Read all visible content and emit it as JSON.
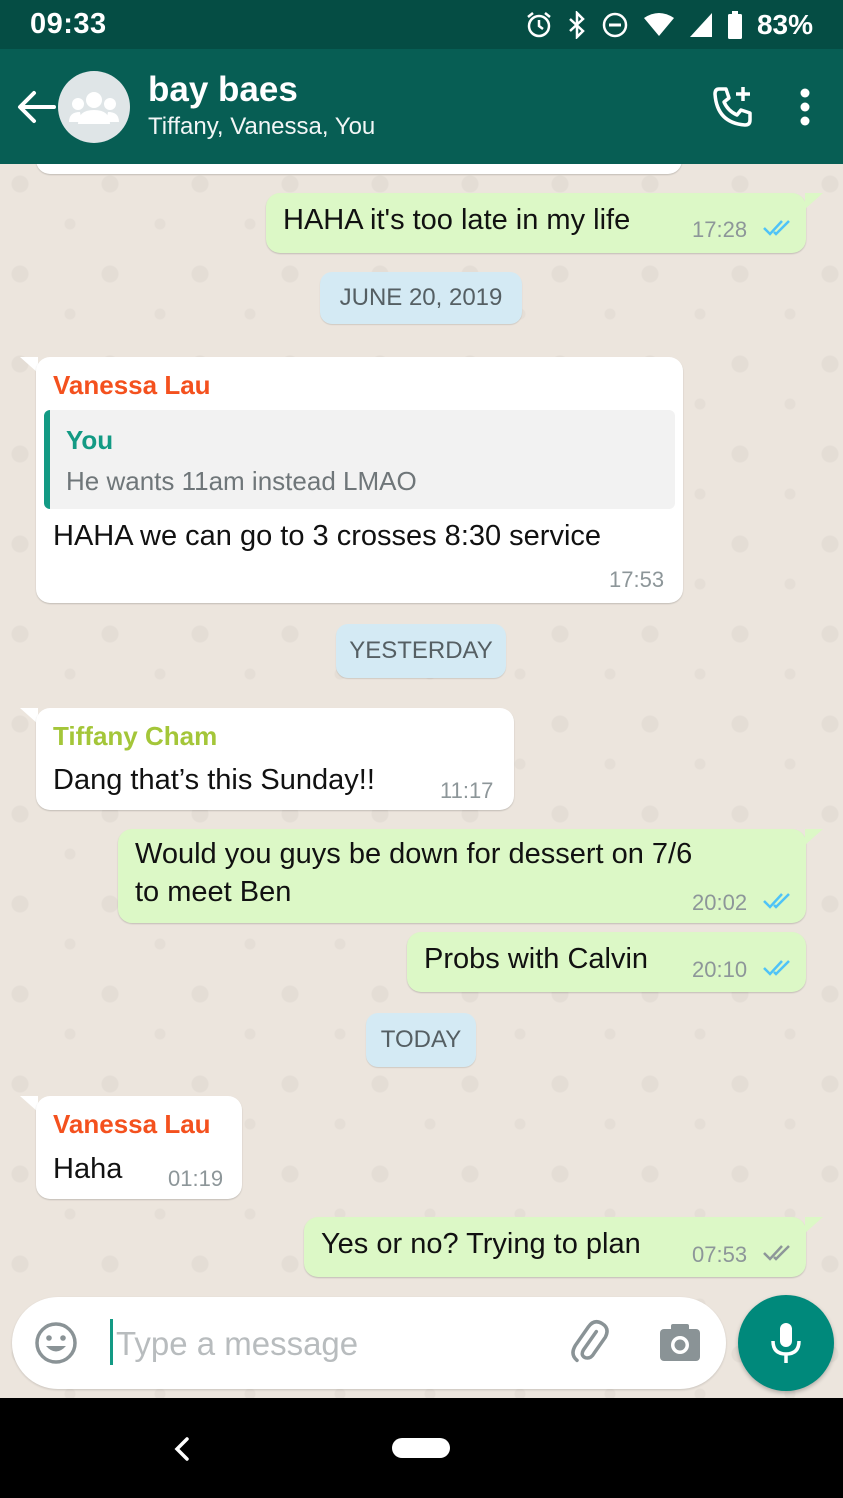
{
  "status_bar": {
    "time": "09:33",
    "battery": "83%"
  },
  "header": {
    "title": "bay baes",
    "subtitle": "Tiffany, Vanessa, You",
    "icons": [
      "back-arrow-icon",
      "group-avatar-icon",
      "add-call-icon",
      "more-vert-icon"
    ]
  },
  "messages": {
    "m1": {
      "text": "HAHA it's too late in my life",
      "time": "17:28",
      "status": "read"
    },
    "date1": "JUNE 20, 2019",
    "m2": {
      "sender": "Vanessa Lau",
      "quote_author": "You",
      "quote_text": "He wants 11am instead LMAO",
      "text": "HAHA we can go to 3 crosses 8:30 service",
      "time": "17:53"
    },
    "date2": "YESTERDAY",
    "m3": {
      "sender": "Tiffany Cham",
      "text": "Dang that’s this Sunday!!",
      "time": "11:17"
    },
    "m4": {
      "line1": "Would you guys be down for dessert on 7/6",
      "line2": "to meet Ben",
      "time": "20:02",
      "status": "read"
    },
    "m5": {
      "text": "Probs with Calvin",
      "time": "20:10",
      "status": "read"
    },
    "date3": "TODAY",
    "m6": {
      "sender": "Vanessa Lau",
      "text": "Haha",
      "time": "01:19"
    },
    "m7": {
      "text": "Yes or no? Trying to plan",
      "time": "07:53",
      "status": "delivered"
    }
  },
  "composer": {
    "placeholder": "Type a message"
  },
  "colors": {
    "header": "#075e54",
    "statusbar": "#054d44",
    "outgoing_bubble": "#dcf8c6",
    "vanessa_name": "#f4511e",
    "tiffany_name": "#a4c639",
    "quote_author": "#139a84",
    "read_ticks": "#4fc3f7"
  }
}
